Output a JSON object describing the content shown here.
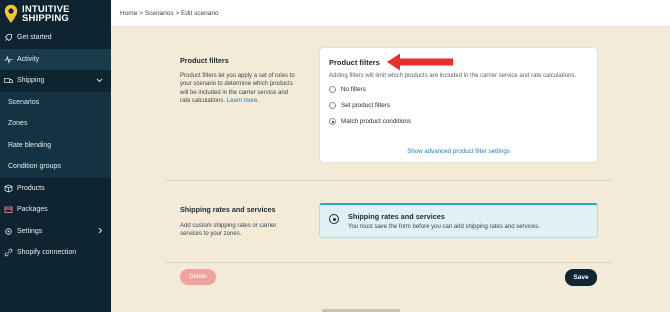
{
  "brand": {
    "line1": "INTUITIVE",
    "line2": "SHIPPING",
    "pin_color": "#f6c531"
  },
  "sidebar": {
    "items": [
      {
        "label": "Get started",
        "icon": "rocket-icon"
      },
      {
        "label": "Activity",
        "icon": "activity-icon"
      },
      {
        "label": "Shipping",
        "icon": "truck-icon"
      },
      {
        "label": "Scenarios"
      },
      {
        "label": "Zones"
      },
      {
        "label": "Rate blending"
      },
      {
        "label": "Condition groups"
      },
      {
        "label": "Products",
        "icon": "box-icon"
      },
      {
        "label": "Packages",
        "icon": "package-icon"
      },
      {
        "label": "Settings",
        "icon": "gear-icon"
      },
      {
        "label": "Shopify connection",
        "icon": "link-icon"
      }
    ]
  },
  "breadcrumb": "Home > Scenarios > Edit scenario",
  "product_filters": {
    "section_label": "Product filters",
    "section_desc": "Product filters let you apply a set of rules to your scenario to determine which products will be included in the carrier service and rate calculations.",
    "learn_more": "Learn more",
    "card_title": "Product filters",
    "card_sub": "Adding filters will limit which products are included in the carrier service and rate calculations.",
    "options": [
      "No filters",
      "Set product filters",
      "Match product conditions"
    ],
    "selected_index": 2,
    "advanced_link": "Show advanced product filter settings"
  },
  "shipping_rates": {
    "section_label": "Shipping rates and services",
    "section_desc": "Add custom shipping rates or carrier services to your zones.",
    "notice_title": "Shipping rates and services",
    "notice_text": "You must save the form before you can add shipping rates and services."
  },
  "actions": {
    "delete": "Delete",
    "save": "Save"
  },
  "colors": {
    "accent": "#1a7eb8",
    "arrow": "#e62e2e",
    "save_bg": "#0f2733",
    "delete_bg": "#f0a39c"
  }
}
